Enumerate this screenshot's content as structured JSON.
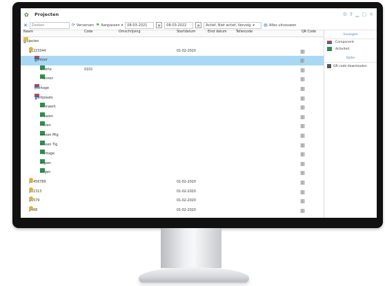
{
  "window": {
    "title": "Projecten"
  },
  "toolbar": {
    "search_placeholder": "Zoeken",
    "refresh_label": "Verversen",
    "filter_label": "Aanpassen",
    "date_from": "08-03-2021",
    "date_to": "08-03-2022",
    "status_filter": "Actief, Niet actief, Vervolg",
    "expand_label": "Alles uitvouwen"
  },
  "columns": {
    "name": "Naam",
    "code": "Code",
    "description": "Omschrijving",
    "start": "Startdatum",
    "end": "Eind datum",
    "counter": "Tellercode",
    "qr": "QR Code"
  },
  "rows": [
    {
      "indent": 0,
      "arrow": "◢",
      "icon": "folder",
      "name": "Projecten",
      "code": "",
      "start": "",
      "qr": false,
      "selected": false
    },
    {
      "indent": 1,
      "arrow": "◢",
      "icon": "project",
      "name": "E1223344",
      "code": "",
      "start": "01-02-2020",
      "qr": true,
      "selected": false
    },
    {
      "indent": 2,
      "arrow": "◢",
      "icon": "component",
      "name": "Kantoor",
      "code": "",
      "start": "",
      "qr": true,
      "selected": true
    },
    {
      "indent": 3,
      "arrow": "",
      "icon": "activity",
      "name": "Offerte",
      "code": "0102",
      "start": "",
      "qr": true,
      "selected": false
    },
    {
      "indent": 3,
      "arrow": "",
      "icon": "activity",
      "name": "Plannen",
      "code": "",
      "start": "",
      "qr": true,
      "selected": false
    },
    {
      "indent": 2,
      "arrow": "▷",
      "icon": "component",
      "name": "Montage",
      "code": "",
      "start": "",
      "qr": true,
      "selected": false
    },
    {
      "indent": 2,
      "arrow": "◢",
      "icon": "component",
      "name": "Werkplaats",
      "code": "",
      "start": "",
      "qr": true,
      "selected": false
    },
    {
      "indent": 3,
      "arrow": "",
      "icon": "activity",
      "name": "Boorwerk",
      "code": "",
      "start": "",
      "qr": true,
      "selected": false
    },
    {
      "indent": 3,
      "arrow": "",
      "icon": "activity",
      "name": "Draaien",
      "code": "",
      "start": "",
      "qr": true,
      "selected": false
    },
    {
      "indent": 3,
      "arrow": "",
      "icon": "activity",
      "name": "Frezen",
      "code": "",
      "start": "",
      "qr": true,
      "selected": false
    },
    {
      "indent": 3,
      "arrow": "",
      "icon": "activity",
      "name": "Lassen Mig",
      "code": "",
      "start": "",
      "qr": true,
      "selected": false
    },
    {
      "indent": 3,
      "arrow": "",
      "icon": "activity",
      "name": "Lassen Tig",
      "code": "",
      "start": "",
      "qr": true,
      "selected": false
    },
    {
      "indent": 3,
      "arrow": "",
      "icon": "activity",
      "name": "Montage",
      "code": "",
      "start": "",
      "qr": true,
      "selected": false
    },
    {
      "indent": 3,
      "arrow": "",
      "icon": "activity",
      "name": "Slijpen",
      "code": "",
      "start": "",
      "qr": true,
      "selected": false
    },
    {
      "indent": 3,
      "arrow": "",
      "icon": "activity",
      "name": "Zagen",
      "code": "",
      "start": "",
      "qr": true,
      "selected": false
    },
    {
      "indent": 1,
      "arrow": "▷",
      "icon": "project",
      "name": "12456789",
      "code": "",
      "start": "01-02-2020",
      "qr": true,
      "selected": false
    },
    {
      "indent": 1,
      "arrow": "▷",
      "icon": "project",
      "name": "131313",
      "code": "",
      "start": "01-02-2020",
      "qr": true,
      "selected": false
    },
    {
      "indent": 1,
      "arrow": "▷",
      "icon": "project",
      "name": "13579",
      "code": "",
      "start": "01-02-2020",
      "qr": true,
      "selected": false
    },
    {
      "indent": 1,
      "arrow": "▷",
      "icon": "project",
      "name": "2468",
      "code": "",
      "start": "01-02-2020",
      "qr": true,
      "selected": false
    }
  ],
  "side_panel": {
    "insert_header": "Invoegen",
    "component_label": "Component",
    "activity_label": "Activiteit",
    "options_header": "Optie",
    "qr_download_label": "QR code downloaden"
  },
  "colors": {
    "selected_row": "#a9d8f5",
    "accent": "#4a7fb5"
  },
  "icons": [
    "projects-app-icon",
    "close-icon",
    "refresh-icon",
    "filter-icon",
    "calendar-icon",
    "expand-all-icon",
    "folder-icon",
    "project-icon",
    "component-icon",
    "activity-icon",
    "qr-code-icon"
  ]
}
